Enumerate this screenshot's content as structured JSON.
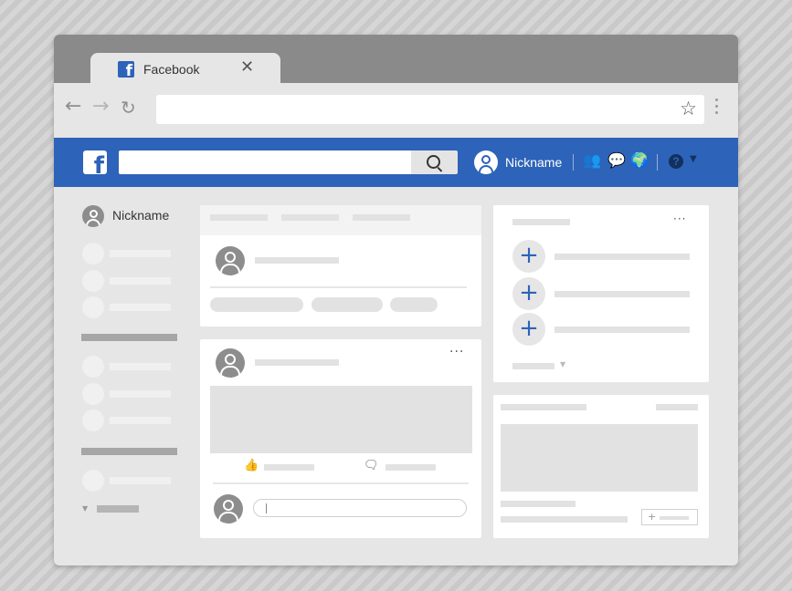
{
  "browser": {
    "tab": {
      "title": "Facebook",
      "favicon": "facebook-f-icon",
      "close_icon": "close-icon"
    },
    "nav": {
      "back_icon": "back-arrow-icon",
      "forward_icon": "forward-arrow-icon",
      "reload_icon": "reload-icon"
    },
    "address_bar": {
      "value": "",
      "bookmark_icon": "star-icon"
    },
    "menu_icon": "kebab-menu-icon"
  },
  "facebook_bar": {
    "logo_icon": "facebook-logo-icon",
    "search": {
      "value": "",
      "icon": "search-icon"
    },
    "profile": {
      "nickname": "Nickname",
      "avatar_icon": "user-avatar-icon"
    },
    "icons": [
      "friends-icon",
      "messenger-icon",
      "globe-icon",
      "help-icon",
      "caret-down-icon"
    ]
  },
  "sidebar": {
    "profile_name": "Nickname",
    "collapse_icon": "caret-down-icon"
  },
  "colors": {
    "brand_blue": "#2d63b8",
    "dark_icon": "#13305e",
    "window_bg": "#e6e6e6",
    "tab_strip": "#8a8a8a",
    "placeholder": "#e2e2e2"
  },
  "icons": {
    "back": "←",
    "forward": "→",
    "reload": "↻",
    "star": "☆",
    "close": "✕",
    "friends": "👥",
    "messenger": "💬",
    "globe": "🌍",
    "help": "?",
    "caret": "▼",
    "like": "👍",
    "comment": "🗨",
    "plus": "+",
    "more": "···"
  }
}
